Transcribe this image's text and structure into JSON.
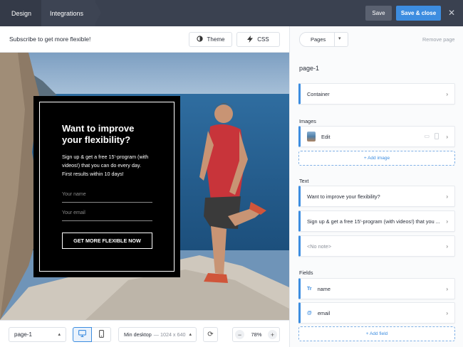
{
  "topbar": {
    "tabs": [
      "Design",
      "Integrations"
    ],
    "save_label": "Save",
    "save_close_label": "Save & close",
    "close_symbol": "✕"
  },
  "toolbar": {
    "title": "Subscribe to get more flexible!",
    "theme_label": "Theme",
    "css_label": "CSS"
  },
  "popup": {
    "headline": "Want to improve your flexibility?",
    "body_line1": "Sign up & get a free 15'-program (with videos!) that you can do every day.",
    "body_line2": "First results within 10 days!",
    "name_placeholder": "Your name",
    "email_placeholder": "Your email",
    "cta_label": "GET MORE FLEXIBLE NOW"
  },
  "bottombar": {
    "page_select": "page-1",
    "size_select_main": "Min desktop",
    "size_select_dims": "— 1024 x 640",
    "zoom": "78%"
  },
  "panel": {
    "pages_label": "Pages",
    "remove_page": "Remove page",
    "page_name": "page-1",
    "container_label": "Container",
    "images_heading": "Images",
    "image_edit_label": "Edit",
    "add_image_label": "+ Add image",
    "text_heading": "Text",
    "text_items": [
      "Want to improve your flexibility?",
      "Sign up & get a free 15'-program (with videos!) that you ...",
      "<No note>"
    ],
    "fields_heading": "Fields",
    "field_items": [
      {
        "icon": "Tr",
        "label": "name"
      },
      {
        "icon": "@",
        "label": "email"
      }
    ],
    "add_field_label": "+ Add field"
  },
  "colors": {
    "accent": "#3d8de0",
    "topbar": "#3a4150",
    "popup": "#000000"
  }
}
